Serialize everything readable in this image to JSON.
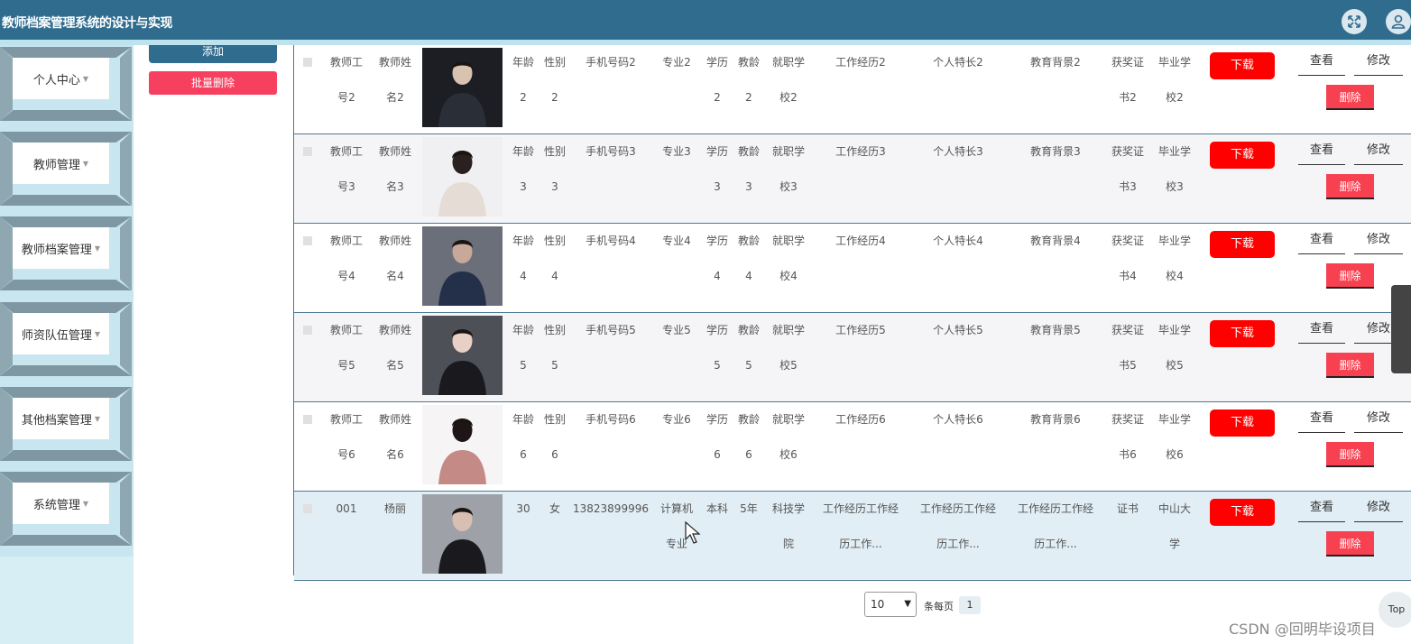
{
  "header": {
    "title": "教师档案管理系统的设计与实现",
    "fullscreen_icon": "fullscreen-icon",
    "user_icon": "user-icon"
  },
  "sidebar": {
    "items": [
      {
        "label": "个人中心"
      },
      {
        "label": "教师管理"
      },
      {
        "label": "教师档案管理"
      },
      {
        "label": "师资队伍管理"
      },
      {
        "label": "其他档案管理"
      },
      {
        "label": "系统管理"
      }
    ]
  },
  "actions": {
    "add_label": "添加",
    "batch_delete_label": "批量删除"
  },
  "table": {
    "rows": [
      {
        "id_l1": "教师工",
        "id_l2": "号2",
        "name_l1": "教师姓",
        "name_l2": "名2",
        "age_l1": "年龄",
        "age_l2": "2",
        "gender_l1": "性别",
        "gender_l2": "2",
        "phone": "手机号码2",
        "major_l1": "专业2",
        "major_l2": "",
        "edu_l1": "学历",
        "edu_l2": "2",
        "years_l1": "教龄",
        "years_l2": "2",
        "school_l1": "就职学",
        "school_l2": "校2",
        "work_l1": "工作经历2",
        "work_l2": "",
        "skill_l1": "个人特长2",
        "skill_l2": "",
        "bg_l1": "教育背景2",
        "bg_l2": "",
        "cert_l1": "获奖证",
        "cert_l2": "书2",
        "grad_l1": "毕业学",
        "grad_l2": "校2"
      },
      {
        "id_l1": "教师工",
        "id_l2": "号3",
        "name_l1": "教师姓",
        "name_l2": "名3",
        "age_l1": "年龄",
        "age_l2": "3",
        "gender_l1": "性别",
        "gender_l2": "3",
        "phone": "手机号码3",
        "major_l1": "专业3",
        "major_l2": "",
        "edu_l1": "学历",
        "edu_l2": "3",
        "years_l1": "教龄",
        "years_l2": "3",
        "school_l1": "就职学",
        "school_l2": "校3",
        "work_l1": "工作经历3",
        "work_l2": "",
        "skill_l1": "个人特长3",
        "skill_l2": "",
        "bg_l1": "教育背景3",
        "bg_l2": "",
        "cert_l1": "获奖证",
        "cert_l2": "书3",
        "grad_l1": "毕业学",
        "grad_l2": "校3"
      },
      {
        "id_l1": "教师工",
        "id_l2": "号4",
        "name_l1": "教师姓",
        "name_l2": "名4",
        "age_l1": "年龄",
        "age_l2": "4",
        "gender_l1": "性别",
        "gender_l2": "4",
        "phone": "手机号码4",
        "major_l1": "专业4",
        "major_l2": "",
        "edu_l1": "学历",
        "edu_l2": "4",
        "years_l1": "教龄",
        "years_l2": "4",
        "school_l1": "就职学",
        "school_l2": "校4",
        "work_l1": "工作经历4",
        "work_l2": "",
        "skill_l1": "个人特长4",
        "skill_l2": "",
        "bg_l1": "教育背景4",
        "bg_l2": "",
        "cert_l1": "获奖证",
        "cert_l2": "书4",
        "grad_l1": "毕业学",
        "grad_l2": "校4"
      },
      {
        "id_l1": "教师工",
        "id_l2": "号5",
        "name_l1": "教师姓",
        "name_l2": "名5",
        "age_l1": "年龄",
        "age_l2": "5",
        "gender_l1": "性别",
        "gender_l2": "5",
        "phone": "手机号码5",
        "major_l1": "专业5",
        "major_l2": "",
        "edu_l1": "学历",
        "edu_l2": "5",
        "years_l1": "教龄",
        "years_l2": "5",
        "school_l1": "就职学",
        "school_l2": "校5",
        "work_l1": "工作经历5",
        "work_l2": "",
        "skill_l1": "个人特长5",
        "skill_l2": "",
        "bg_l1": "教育背景5",
        "bg_l2": "",
        "cert_l1": "获奖证",
        "cert_l2": "书5",
        "grad_l1": "毕业学",
        "grad_l2": "校5"
      },
      {
        "id_l1": "教师工",
        "id_l2": "号6",
        "name_l1": "教师姓",
        "name_l2": "名6",
        "age_l1": "年龄",
        "age_l2": "6",
        "gender_l1": "性别",
        "gender_l2": "6",
        "phone": "手机号码6",
        "major_l1": "专业6",
        "major_l2": "",
        "edu_l1": "学历",
        "edu_l2": "6",
        "years_l1": "教龄",
        "years_l2": "6",
        "school_l1": "就职学",
        "school_l2": "校6",
        "work_l1": "工作经历6",
        "work_l2": "",
        "skill_l1": "个人特长6",
        "skill_l2": "",
        "bg_l1": "教育背景6",
        "bg_l2": "",
        "cert_l1": "获奖证",
        "cert_l2": "书6",
        "grad_l1": "毕业学",
        "grad_l2": "校6"
      },
      {
        "id_l1": "001",
        "id_l2": "",
        "name_l1": "杨丽",
        "name_l2": "",
        "age_l1": "30",
        "age_l2": "",
        "gender_l1": "女",
        "gender_l2": "",
        "phone": "13823899996",
        "major_l1": "计算机",
        "major_l2": "专业",
        "edu_l1": "本科",
        "edu_l2": "",
        "years_l1": "5年",
        "years_l2": "",
        "school_l1": "科技学",
        "school_l2": "院",
        "work_l1": "工作经历工作经",
        "work_l2": "历工作...",
        "skill_l1": "工作经历工作经",
        "skill_l2": "历工作...",
        "bg_l1": "工作经历工作经",
        "bg_l2": "历工作...",
        "cert_l1": "证书",
        "cert_l2": "",
        "grad_l1": "中山大",
        "grad_l2": "学"
      }
    ],
    "download_label": "下载",
    "view_label": "查看",
    "edit_label": "修改",
    "delete_label": "删除"
  },
  "pagination": {
    "page_size": "10",
    "per_page_label": "条每页",
    "current_page": "1"
  },
  "misc": {
    "top_label": "Top",
    "watermark": "CSDN @回明毕设项目"
  }
}
